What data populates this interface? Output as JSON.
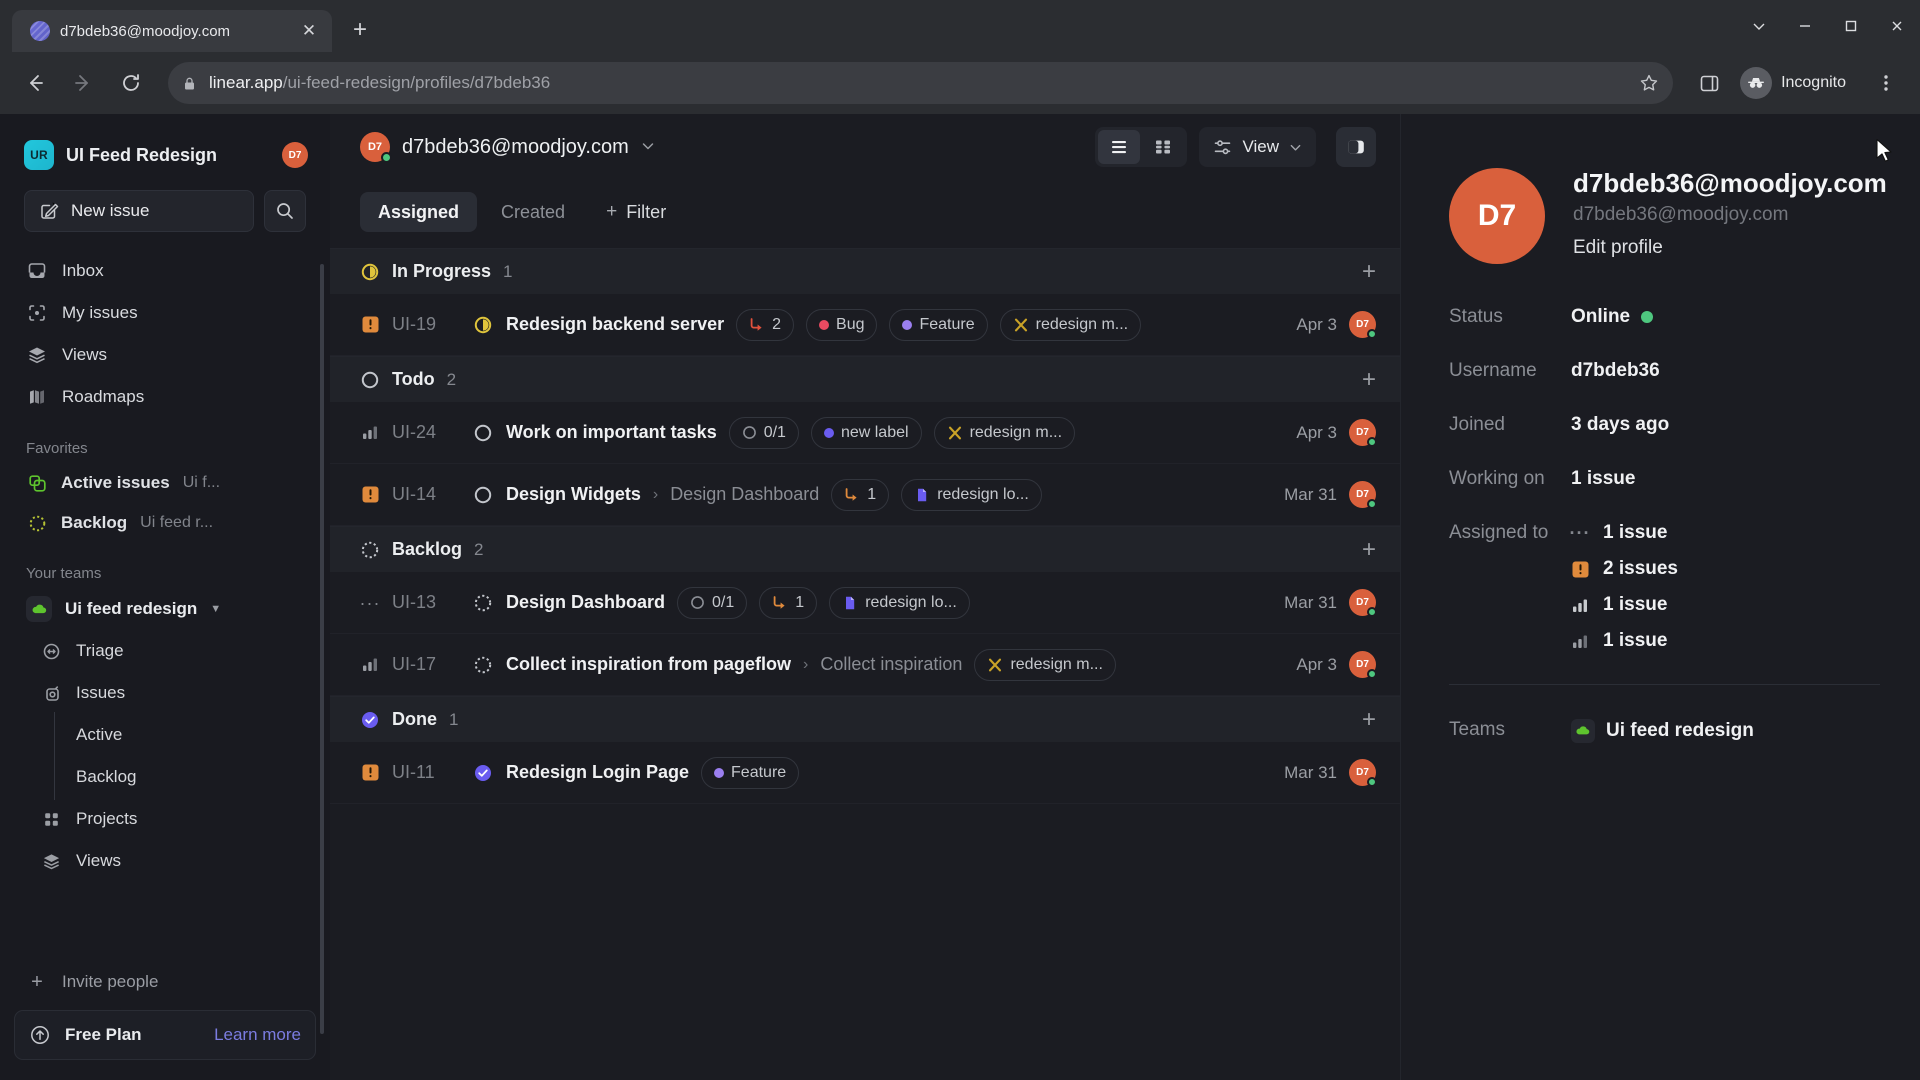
{
  "browser": {
    "tab_title": "d7bdeb36@moodjoy.com",
    "close_label": "✕",
    "newtab_label": "+",
    "url_host": "linear.app",
    "url_path": "/ui-feed-redesign/profiles/d7bdeb36",
    "incognito_label": "Incognito"
  },
  "sidebar": {
    "workspace_initials": "UR",
    "workspace_name": "UI Feed Redesign",
    "workspace_avatar": "D7",
    "new_issue_label": "New issue",
    "nav": [
      {
        "label": "Inbox",
        "icon": "inbox-icon"
      },
      {
        "label": "My issues",
        "icon": "my-issues-icon"
      },
      {
        "label": "Views",
        "icon": "views-icon"
      },
      {
        "label": "Roadmaps",
        "icon": "roadmaps-icon"
      }
    ],
    "favorites_label": "Favorites",
    "favorites": [
      {
        "label": "Active issues",
        "sub": "Ui f..."
      },
      {
        "label": "Backlog",
        "sub": "Ui feed r..."
      }
    ],
    "teams_label": "Your teams",
    "team_name": "Ui feed redesign",
    "team_items": [
      {
        "label": "Triage",
        "icon": "triage-icon"
      },
      {
        "label": "Issues",
        "icon": "issues-icon"
      }
    ],
    "team_leaves": [
      "Active",
      "Backlog"
    ],
    "team_items_2": [
      {
        "label": "Projects",
        "icon": "projects-icon"
      },
      {
        "label": "Views",
        "icon": "views-icon"
      }
    ],
    "invite_label": "Invite people",
    "plan_name": "Free Plan",
    "plan_link": "Learn more"
  },
  "header": {
    "avatar": "D7",
    "title": "d7bdeb36@moodjoy.com",
    "view_label": "View"
  },
  "filters": {
    "tabs": [
      {
        "label": "Assigned",
        "active": true
      },
      {
        "label": "Created",
        "active": false
      }
    ],
    "filter_label": "Filter",
    "filter_plus": "+"
  },
  "groups": [
    {
      "label": "In Progress",
      "count": "1",
      "state": "in-progress",
      "rows": [
        {
          "priority": "urgent",
          "id": "UI-19",
          "state": "in-progress",
          "title": "Redesign backend server",
          "crumb": "",
          "chips": [
            {
              "kind": "sub",
              "text": "2",
              "icon": "sub-issue-icon",
              "color": "#e0513c"
            },
            {
              "kind": "label",
              "text": "Bug",
              "color": "#eb4a61"
            },
            {
              "kind": "label",
              "text": "Feature",
              "color": "#9b7ff0"
            },
            {
              "kind": "project",
              "text": "redesign m...",
              "icon": "project-x-icon",
              "color": "#c9a227"
            }
          ],
          "date": "Apr 3",
          "avatar": "D7"
        }
      ]
    },
    {
      "label": "Todo",
      "count": "2",
      "state": "todo",
      "rows": [
        {
          "priority": "medium",
          "id": "UI-24",
          "state": "todo",
          "title": "Work on important tasks",
          "crumb": "",
          "chips": [
            {
              "kind": "progress",
              "text": "0/1",
              "icon": "progress-icon",
              "color": "#8a8d94"
            },
            {
              "kind": "label",
              "text": "new label",
              "color": "#6a5cf0"
            },
            {
              "kind": "project",
              "text": "redesign m...",
              "icon": "project-x-icon",
              "color": "#c9a227"
            }
          ],
          "date": "Apr 3",
          "avatar": "D7"
        },
        {
          "priority": "urgent",
          "id": "UI-14",
          "state": "todo",
          "title": "Design Widgets",
          "crumb": "Design Dashboard",
          "chips": [
            {
              "kind": "sub",
              "text": "1",
              "icon": "sub-issue-icon",
              "color": "#e08a3c"
            },
            {
              "kind": "project",
              "text": "redesign lo...",
              "icon": "project-doc-icon",
              "color": "#6a5cf0"
            }
          ],
          "date": "Mar 31",
          "avatar": "D7"
        }
      ]
    },
    {
      "label": "Backlog",
      "count": "2",
      "state": "backlog",
      "rows": [
        {
          "priority": "none",
          "id": "UI-13",
          "state": "backlog",
          "title": "Design Dashboard",
          "crumb": "",
          "chips": [
            {
              "kind": "progress",
              "text": "0/1",
              "icon": "progress-icon",
              "color": "#8a8d94"
            },
            {
              "kind": "sub",
              "text": "1",
              "icon": "sub-issue-icon",
              "color": "#e08a3c"
            },
            {
              "kind": "project",
              "text": "redesign lo...",
              "icon": "project-doc-icon",
              "color": "#6a5cf0"
            }
          ],
          "date": "Mar 31",
          "avatar": "D7"
        },
        {
          "priority": "medium",
          "id": "UI-17",
          "state": "backlog",
          "title": "Collect inspiration from pageflow",
          "crumb": "Collect inspiration",
          "chips": [
            {
              "kind": "project",
              "text": "redesign m...",
              "icon": "project-x-icon",
              "color": "#c9a227"
            }
          ],
          "date": "Apr 3",
          "avatar": "D7"
        }
      ]
    },
    {
      "label": "Done",
      "count": "1",
      "state": "done",
      "rows": [
        {
          "priority": "urgent",
          "id": "UI-11",
          "state": "done",
          "title": "Redesign Login Page",
          "crumb": "",
          "chips": [
            {
              "kind": "label",
              "text": "Feature",
              "color": "#9b7ff0"
            }
          ],
          "date": "Mar 31",
          "avatar": "D7"
        }
      ]
    }
  ],
  "profile": {
    "avatar": "D7",
    "name": "d7bdeb36@moodjoy.com",
    "email": "d7bdeb36@moodjoy.com",
    "edit_label": "Edit profile",
    "fields": [
      {
        "key": "Status",
        "value": "Online",
        "badge": "online-dot"
      },
      {
        "key": "Username",
        "value": "d7bdeb36"
      },
      {
        "key": "Joined",
        "value": "3 days ago"
      },
      {
        "key": "Working on",
        "value": "1 issue"
      }
    ],
    "assigned_key": "Assigned to",
    "assigned": [
      {
        "icon": "priority-none-icon",
        "value": "1 issue"
      },
      {
        "icon": "priority-urgent-icon",
        "value": "2 issues"
      },
      {
        "icon": "priority-high-icon",
        "value": "1 issue"
      },
      {
        "icon": "priority-medium-icon",
        "value": "1 issue"
      }
    ],
    "teams_key": "Teams",
    "team_name": "Ui feed redesign"
  },
  "colors": {
    "accent": "#6a5cf0",
    "avatar": "#d9603c",
    "online": "#4ec77f",
    "urgent": "#e08a3c",
    "done": "#6a5cf0",
    "progress": "#e0c53c"
  }
}
